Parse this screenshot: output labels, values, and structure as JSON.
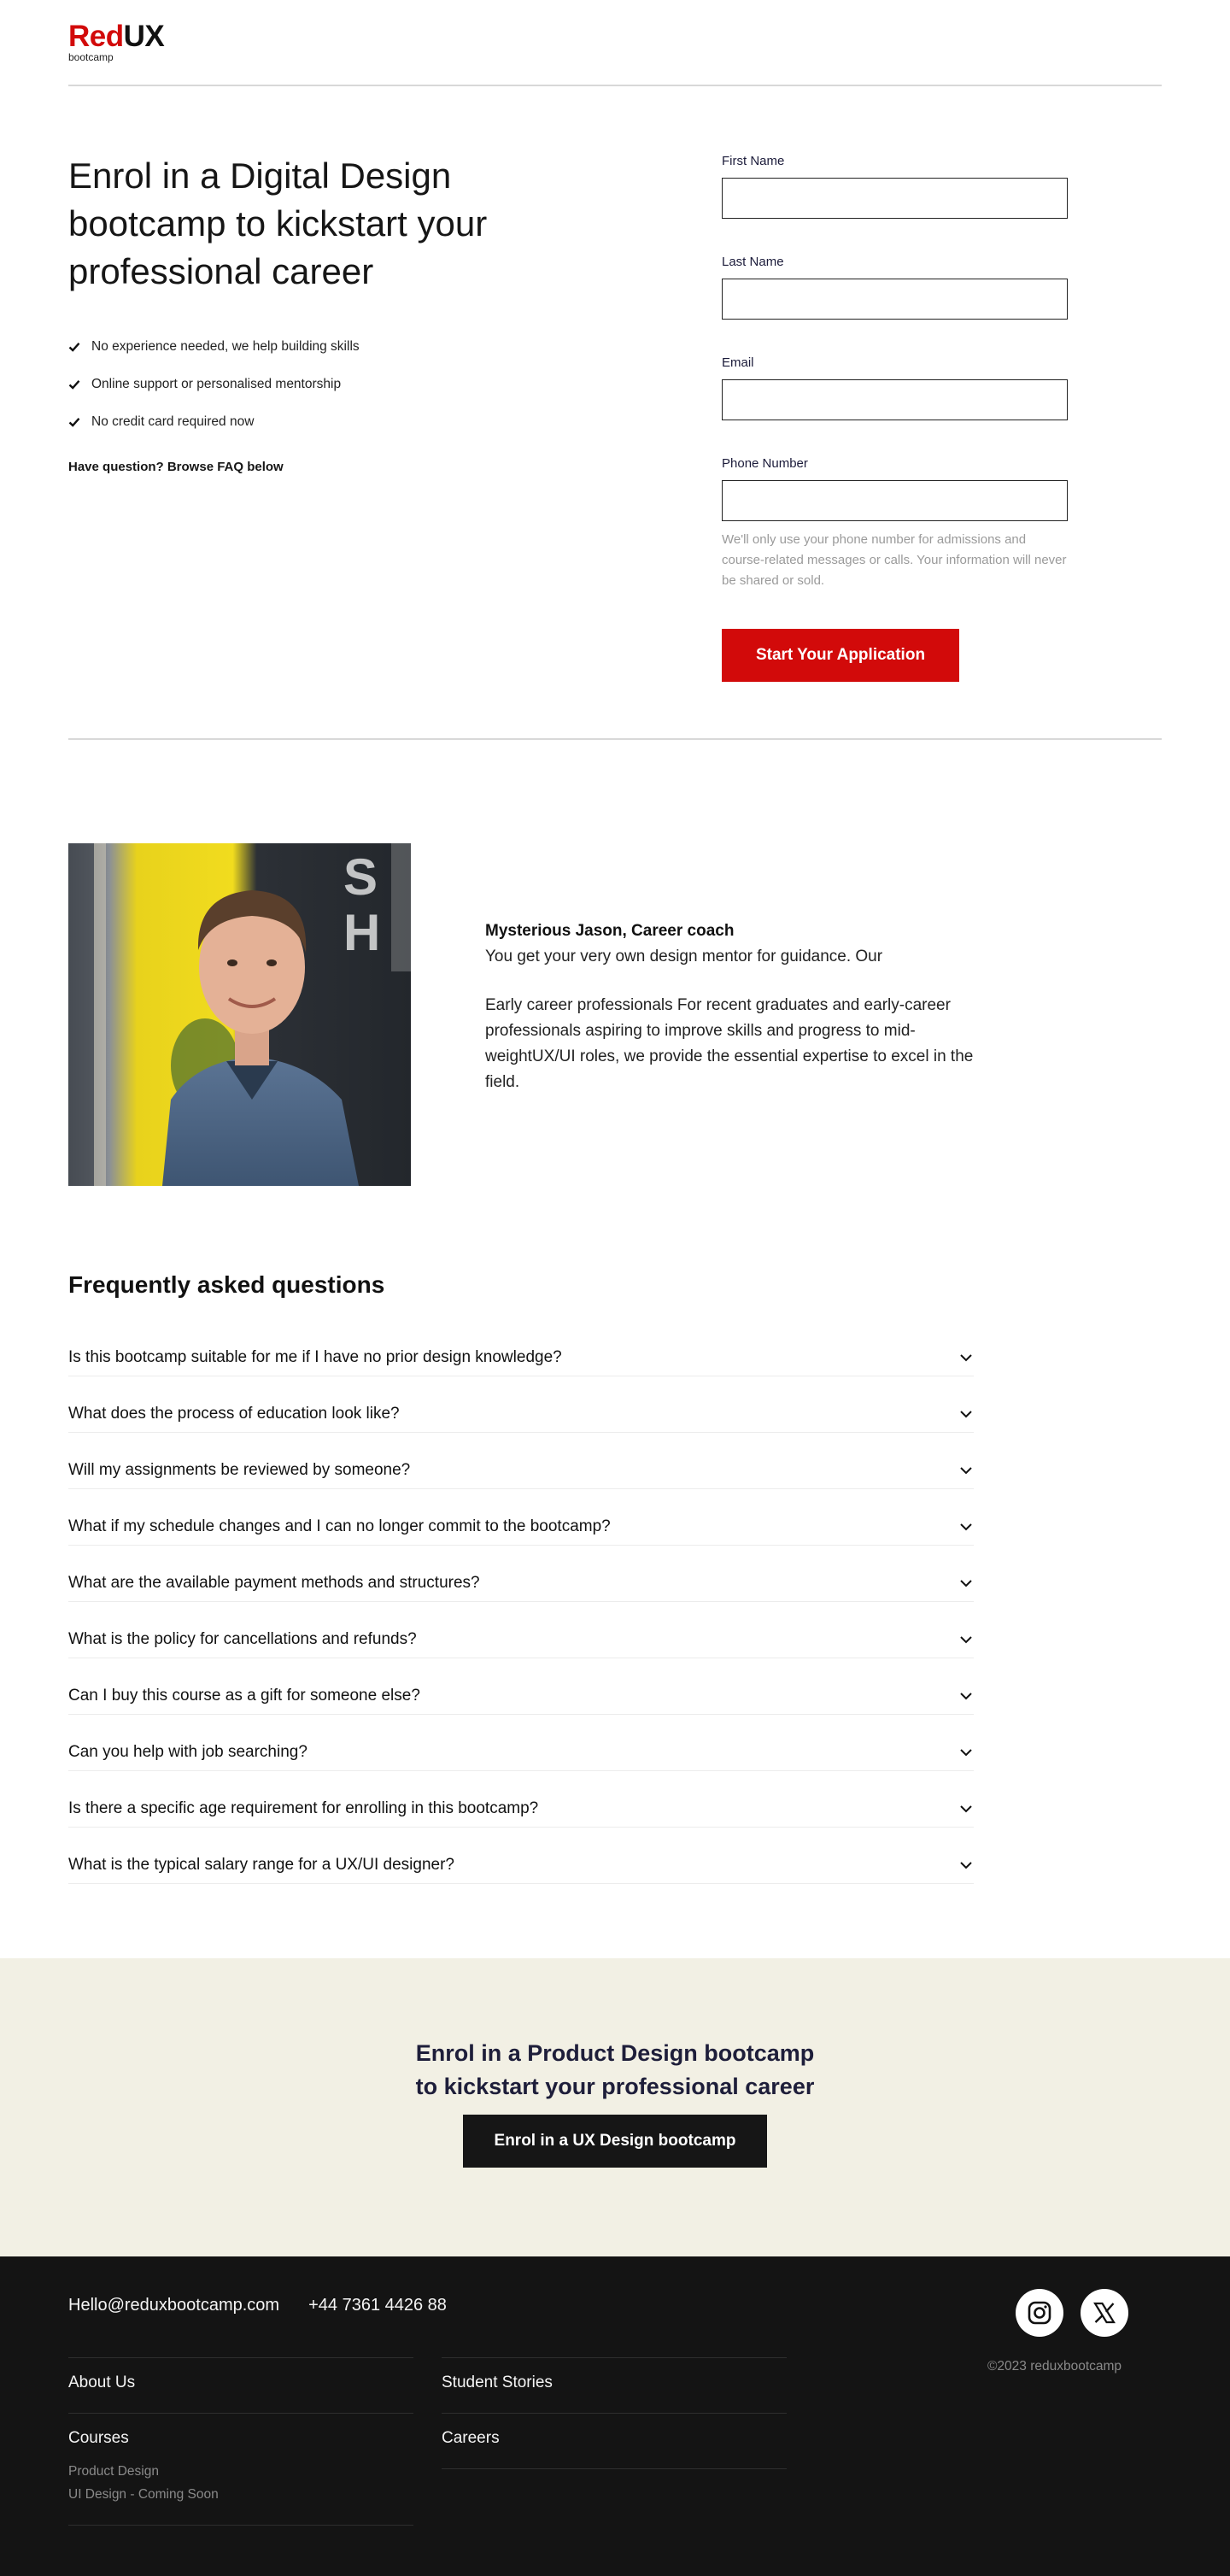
{
  "brand": {
    "name_red": "Red",
    "name_black": "UX",
    "tagline": "bootcamp",
    "accent_color": "#d20a0a"
  },
  "hero": {
    "title": "Enrol in a Digital Design bootcamp to kickstart your professional career",
    "benefits": [
      "No experience needed, we help building skills",
      "Online support or personalised mentorship",
      "No credit card required now"
    ],
    "faq_hint": "Have question? Browse FAQ below"
  },
  "form": {
    "fields": [
      {
        "label": "First Name",
        "value": ""
      },
      {
        "label": "Last Name",
        "value": ""
      },
      {
        "label": "Email",
        "value": ""
      },
      {
        "label": "Phone Number",
        "value": ""
      }
    ],
    "note": "We'll only use your phone number for admissions and course-related messages or calls. Your information will never be shared or sold.",
    "submit_label": "Start Your Application"
  },
  "coach": {
    "name": "Mysterious Jason, Career coach",
    "intro": "You get your very own design mentor for guidance. Our",
    "bio": "Early career professionals For recent graduates and early-career professionals aspiring to improve skills and progress to mid-weightUX/UI roles, we provide the essential expertise to excel in the field.",
    "photo_icon": "person-photo"
  },
  "faq": {
    "title": "Frequently asked questions",
    "questions": [
      "Is this bootcamp suitable for me if I have no prior design knowledge?",
      "What does the process of education look like?",
      "Will my assignments be reviewed by someone?",
      "What if my schedule changes and I can no longer commit to the bootcamp?",
      "What are the available payment methods and structures?",
      "What is the policy for cancellations and refunds?",
      "Can I buy this course as a gift for someone else?",
      "Can you help with job searching?",
      "Is there a specific age requirement for enrolling in this bootcamp?",
      "What is the typical salary range for a UX/UI designer?"
    ]
  },
  "cta": {
    "title_line1": "Enrol in a Product Design bootcamp",
    "title_line2": "to kickstart your professional career",
    "button_label": "Enrol in a UX Design bootcamp",
    "background": "#f2f0e4"
  },
  "footer": {
    "email": "Hello@reduxbootcamp.com",
    "phone": "+44 7361 4426 88",
    "col_a": {
      "about": "About Us",
      "courses": "Courses",
      "course_items": [
        "Product Design",
        "UI Design - Coming Soon"
      ]
    },
    "col_b": {
      "stories": "Student Stories",
      "careers": "Careers"
    },
    "social": [
      "instagram-icon",
      "x-icon"
    ],
    "copyright": "©2023 reduxbootcamp",
    "background": "#141414"
  }
}
